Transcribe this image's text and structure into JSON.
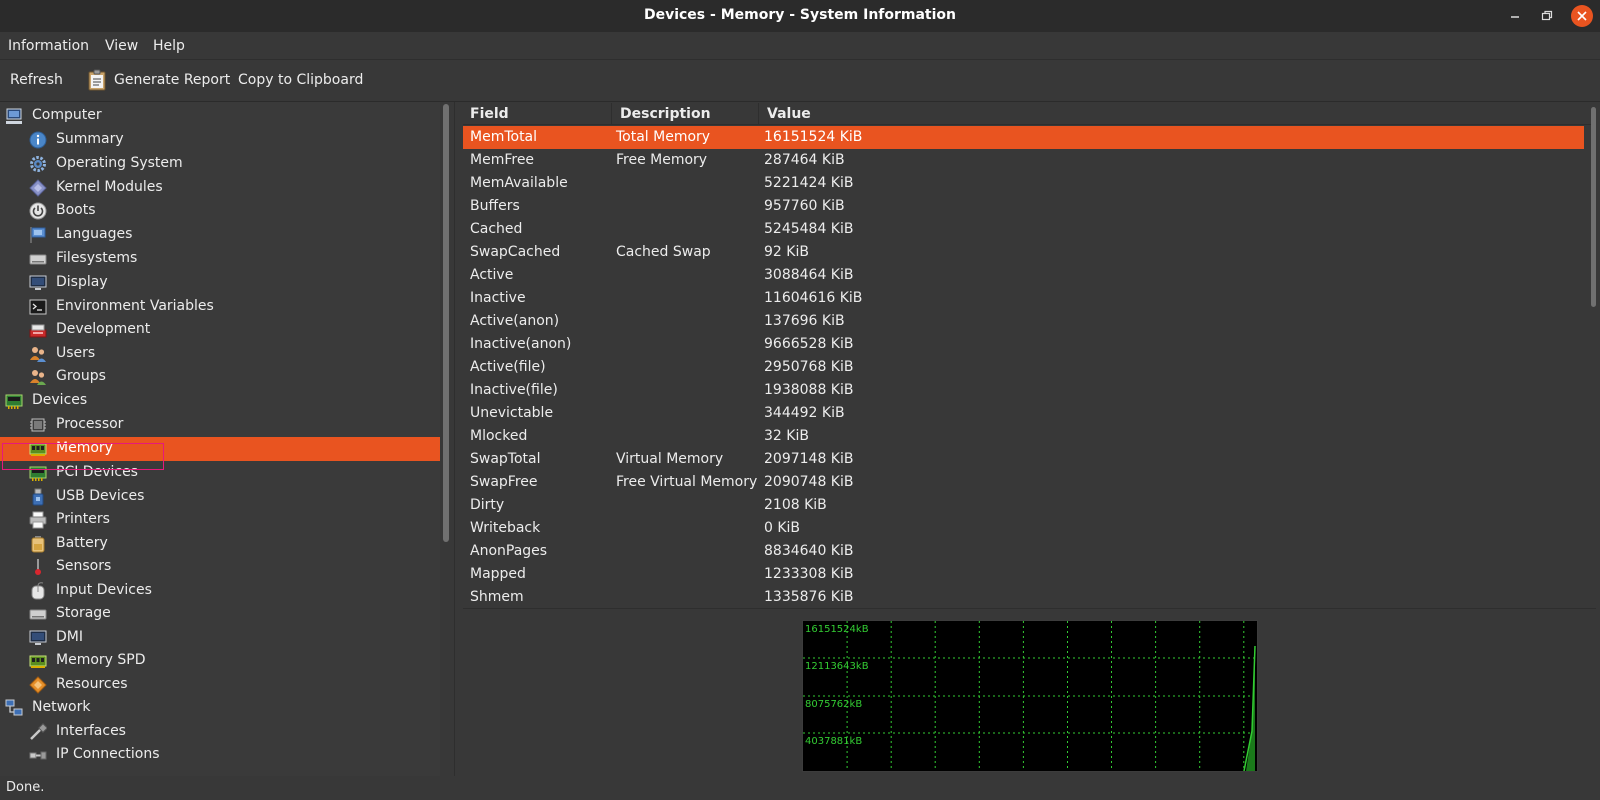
{
  "window": {
    "title": "Devices - Memory - System Information"
  },
  "menu": [
    "Information",
    "View",
    "Help"
  ],
  "toolbar": {
    "refresh": "Refresh",
    "generate_report": "Generate Report",
    "copy": "Copy to Clipboard"
  },
  "tree": [
    {
      "label": "Computer",
      "icon": "computer-icon",
      "level": 0
    },
    {
      "label": "Summary",
      "icon": "info-icon",
      "level": 1
    },
    {
      "label": "Operating System",
      "icon": "gear-icon",
      "level": 1
    },
    {
      "label": "Kernel Modules",
      "icon": "module-icon",
      "level": 1
    },
    {
      "label": "Boots",
      "icon": "power-icon",
      "level": 1
    },
    {
      "label": "Languages",
      "icon": "flag-icon",
      "level": 1
    },
    {
      "label": "Filesystems",
      "icon": "drive-icon",
      "level": 1
    },
    {
      "label": "Display",
      "icon": "monitor-icon",
      "level": 1
    },
    {
      "label": "Environment Variables",
      "icon": "terminal-icon",
      "level": 1
    },
    {
      "label": "Development",
      "icon": "development-icon",
      "level": 1
    },
    {
      "label": "Users",
      "icon": "users-icon",
      "level": 1
    },
    {
      "label": "Groups",
      "icon": "groups-icon",
      "level": 1
    },
    {
      "label": "Devices",
      "icon": "board-icon",
      "level": 0
    },
    {
      "label": "Processor",
      "icon": "cpu-icon",
      "level": 1
    },
    {
      "label": "Memory",
      "icon": "memory-icon",
      "level": 1,
      "selected": true
    },
    {
      "label": "PCI Devices",
      "icon": "board-icon",
      "level": 1
    },
    {
      "label": "USB Devices",
      "icon": "usb-icon",
      "level": 1
    },
    {
      "label": "Printers",
      "icon": "printer-icon",
      "level": 1
    },
    {
      "label": "Battery",
      "icon": "battery-icon",
      "level": 1
    },
    {
      "label": "Sensors",
      "icon": "sensor-icon",
      "level": 1
    },
    {
      "label": "Input Devices",
      "icon": "keyboard-icon",
      "level": 1
    },
    {
      "label": "Storage",
      "icon": "drive-icon",
      "level": 1
    },
    {
      "label": "DMI",
      "icon": "monitor-icon",
      "level": 1
    },
    {
      "label": "Memory SPD",
      "icon": "memory-icon",
      "level": 1
    },
    {
      "label": "Resources",
      "icon": "resources-icon",
      "level": 1
    },
    {
      "label": "Network",
      "icon": "network-icon",
      "level": 0
    },
    {
      "label": "Interfaces",
      "icon": "interfaces-icon",
      "level": 1
    },
    {
      "label": "IP Connections",
      "icon": "connections-icon",
      "level": 1
    }
  ],
  "table": {
    "headers": [
      "Field",
      "Description",
      "Value"
    ],
    "rows": [
      [
        "MemTotal",
        "Total Memory",
        "16151524 KiB"
      ],
      [
        "MemFree",
        "Free Memory",
        "287464 KiB"
      ],
      [
        "MemAvailable",
        "",
        "5221424 KiB"
      ],
      [
        "Buffers",
        "",
        "957760 KiB"
      ],
      [
        "Cached",
        "",
        "5245484 KiB"
      ],
      [
        "SwapCached",
        "Cached Swap",
        "92 KiB"
      ],
      [
        "Active",
        "",
        "3088464 KiB"
      ],
      [
        "Inactive",
        "",
        "11604616 KiB"
      ],
      [
        "Active(anon)",
        "",
        "137696 KiB"
      ],
      [
        "Inactive(anon)",
        "",
        "9666528 KiB"
      ],
      [
        "Active(file)",
        "",
        "2950768 KiB"
      ],
      [
        "Inactive(file)",
        "",
        "1938088 KiB"
      ],
      [
        "Unevictable",
        "",
        "344492 KiB"
      ],
      [
        "Mlocked",
        "",
        "32 KiB"
      ],
      [
        "SwapTotal",
        "Virtual Memory",
        "2097148 KiB"
      ],
      [
        "SwapFree",
        "Free Virtual Memory",
        "2090748 KiB"
      ],
      [
        "Dirty",
        "",
        "2108 KiB"
      ],
      [
        "Writeback",
        "",
        "0 KiB"
      ],
      [
        "AnonPages",
        "",
        "8834640 KiB"
      ],
      [
        "Mapped",
        "",
        "1233308 KiB"
      ],
      [
        "Shmem",
        "",
        "1335876 KiB"
      ]
    ],
    "selected_row": 0
  },
  "graph": {
    "labels": [
      "16151524kB",
      "12113643kB",
      "8075762kB",
      "4037881kB"
    ],
    "grid_color": "#33cc33",
    "line_color": "#33cc33",
    "fill_color": "#1a7a1a"
  },
  "status": "Done.",
  "colors": {
    "accent": "#e95420",
    "background": "#383838"
  }
}
